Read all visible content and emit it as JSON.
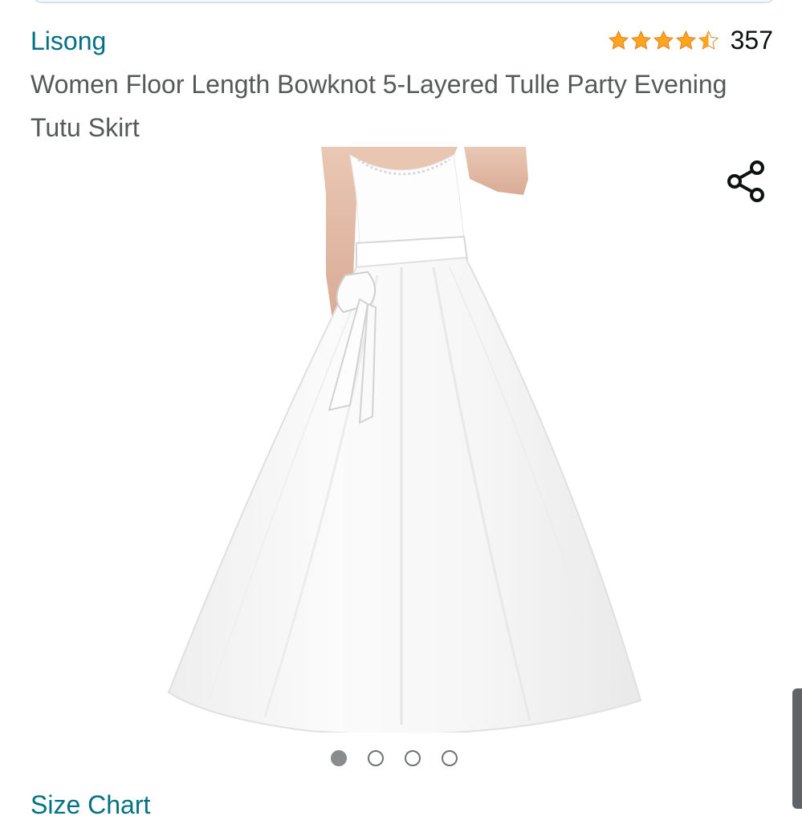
{
  "product": {
    "brand": "Lisong",
    "title": "Women Floor Length Bowknot 5-Layered Tulle Party Evening Tutu Skirt",
    "rating": 4.5,
    "rating_count": "357",
    "star_color": "#ffa41c"
  },
  "gallery": {
    "image_count": 4,
    "active_index": 0,
    "image_subject": "white-tulle-skirt-photo"
  },
  "icons": {
    "share": "share-icon"
  },
  "next_section": {
    "heading": "Size Chart"
  },
  "colors": {
    "link": "#007185",
    "title_text": "#565959"
  }
}
